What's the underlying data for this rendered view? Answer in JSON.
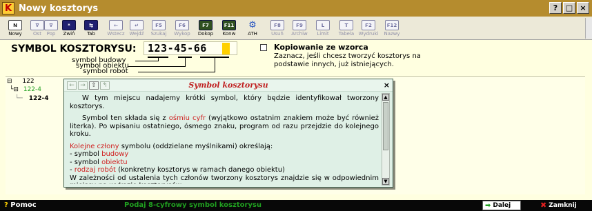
{
  "window": {
    "title": "Nowy kosztorys",
    "app_letter": "K",
    "controls": [
      "?",
      "□",
      "×"
    ]
  },
  "toolbar": {
    "buttons": [
      {
        "icon": "N",
        "label": "Nowy",
        "enabled": true,
        "style": "white"
      },
      {
        "icon": "∇",
        "label": "Ost",
        "enabled": false
      },
      {
        "icon": "∇",
        "label": "Pop",
        "enabled": false
      },
      {
        "icon": "*",
        "label": "Zwiń",
        "enabled": true,
        "style": "dark"
      },
      {
        "icon": "↹",
        "label": "Tab",
        "enabled": true,
        "style": "dark"
      },
      {
        "icon": "←",
        "label": "Wstecz",
        "enabled": false
      },
      {
        "icon": "↵",
        "label": "Wejdź",
        "enabled": false
      },
      {
        "icon": "F5",
        "label": "Szukaj",
        "enabled": false
      },
      {
        "icon": "F6",
        "label": "Wykop",
        "enabled": false
      },
      {
        "icon": "F7",
        "label": "Dokop",
        "enabled": true,
        "style": "green"
      },
      {
        "icon": "F11",
        "label": "Konw",
        "enabled": true,
        "style": "green"
      },
      {
        "icon": "⚙",
        "label": "ATH",
        "enabled": true,
        "style": "ath"
      },
      {
        "icon": "F8",
        "label": "Usuń",
        "enabled": false
      },
      {
        "icon": "F9",
        "label": "Archiw",
        "enabled": false
      },
      {
        "icon": "L",
        "label": "Limit",
        "enabled": false
      },
      {
        "icon": "T",
        "label": "Tabela",
        "enabled": false
      },
      {
        "icon": "F2",
        "label": "Wydruki",
        "enabled": false
      },
      {
        "icon": "F12",
        "label": "Nazwy",
        "enabled": false
      }
    ]
  },
  "symbol": {
    "label": "SYMBOL KOSZTORYSU:",
    "value": "123-45-66",
    "annotations": [
      "symbol budowy",
      "symbol obiektu",
      "symbol robót"
    ]
  },
  "copy_option": {
    "label": "Kopiowanie ze wzorca",
    "checked": false,
    "description": "Zaznacz, jeśli chcesz tworzyć kosztorys na podstawie innych, już istniejących."
  },
  "tree": {
    "items": [
      {
        "prefix": "⊟",
        "text": "122"
      },
      {
        "prefix": "└⊟",
        "text": "122-4"
      },
      {
        "prefix": "└─",
        "text": "122-4"
      }
    ]
  },
  "popup": {
    "title": "Symbol kosztorysu",
    "close": "×",
    "nav": [
      "←",
      "→",
      "⇧",
      "↰"
    ],
    "p1": "W tym miejscu nadajemy krótki symbol, który będzie identyfikował tworzony kosztorys.",
    "p2_a": "Symbol ten składa się z ",
    "p2_red": "ośmiu cyfr",
    "p2_b": " (wyjątkowo ostatnim znakiem może być również literka). Po wpisaniu ostatniego, ósmego znaku, program od razu przejdzie do kolejnego kroku.",
    "p3_red": "Kolejne człony",
    "p3_b": " symbolu (oddzielane myślnikami) określają:",
    "l1_a": "- symbol ",
    "l1_red": "budowy",
    "l2_a": "- symbol ",
    "l2_red": "obiektu",
    "l3_a": "- ",
    "l3_red": "rodzaj robót",
    "l3_b": " (konkretny kosztorys w ramach danego obiektu)",
    "p4": "W zależności od ustalenia tych członów tworzony kosztorys znajdzie się w odpowiednim miejscu na wykazie kosztorysów -"
  },
  "statusbar": {
    "help_q": "?",
    "help_label": "Pomoc",
    "message": "Podaj 8-cyfrowy symbol kosztorysu",
    "next_label": "Dalej",
    "close_label": "Zamknij"
  },
  "colors": {
    "title_bar": "#b58c2e",
    "background": "#ffffe0",
    "popup_bg": "#dff0e6",
    "accent_red": "#d02020",
    "status_green": "#20a020"
  }
}
